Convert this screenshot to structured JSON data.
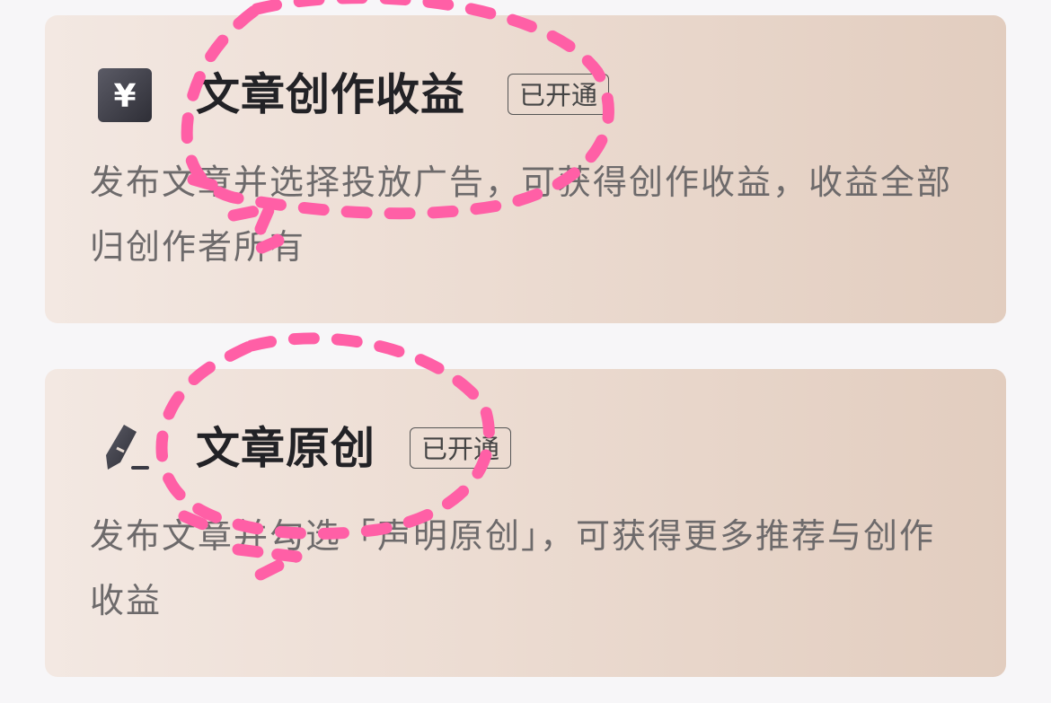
{
  "cards": [
    {
      "icon": "yuan-icon",
      "title": "文章创作收益",
      "badge": "已开通",
      "description": "发布文章并选择投放广告，可获得创作收益，收益全部归创作者所有"
    },
    {
      "icon": "pen-icon",
      "title": "文章原创",
      "badge": "已开通",
      "description": "发布文章并勾选「声明原创」，可获得更多推荐与创作收益"
    }
  ],
  "colors": {
    "annotation": "#ff5fa6",
    "icon_dark": "#4a4a55",
    "card_gradient_start": "#f3e8e2",
    "card_gradient_end": "#e2cdbf"
  }
}
